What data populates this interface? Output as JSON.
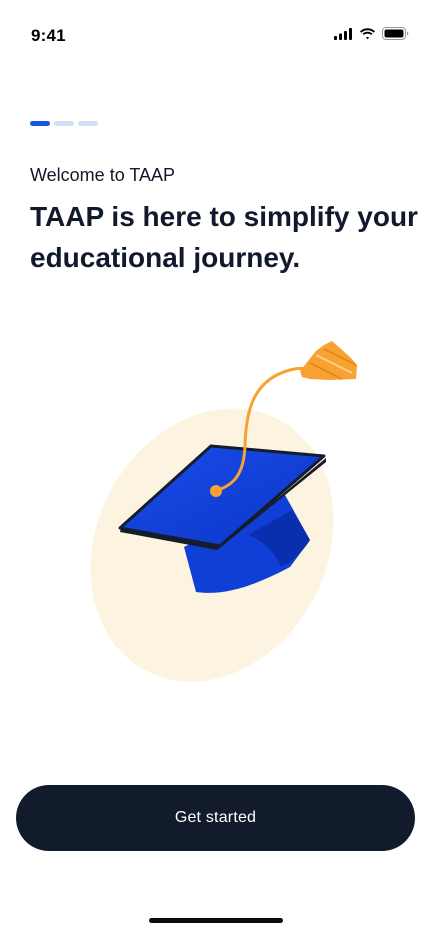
{
  "status_bar": {
    "time": "9:41",
    "icons": [
      "cellular-signal-icon",
      "wifi-icon",
      "battery-icon"
    ]
  },
  "pager": {
    "total": 3,
    "active_index": 0
  },
  "onboarding": {
    "welcome": "Welcome to TAAP",
    "headline": "TAAP is here to simplify your educational journey.",
    "illustration": "graduation-cap-illustration"
  },
  "cta": {
    "label": "Get started"
  },
  "colors": {
    "primary_dark": "#111b2b",
    "accent_blue": "#1356e6",
    "inactive_dot": "#d5e0f7",
    "cap_blue": "#0f3fd6",
    "tassel_orange": "#f7a233",
    "backdrop_cream": "#fdf3e1"
  }
}
